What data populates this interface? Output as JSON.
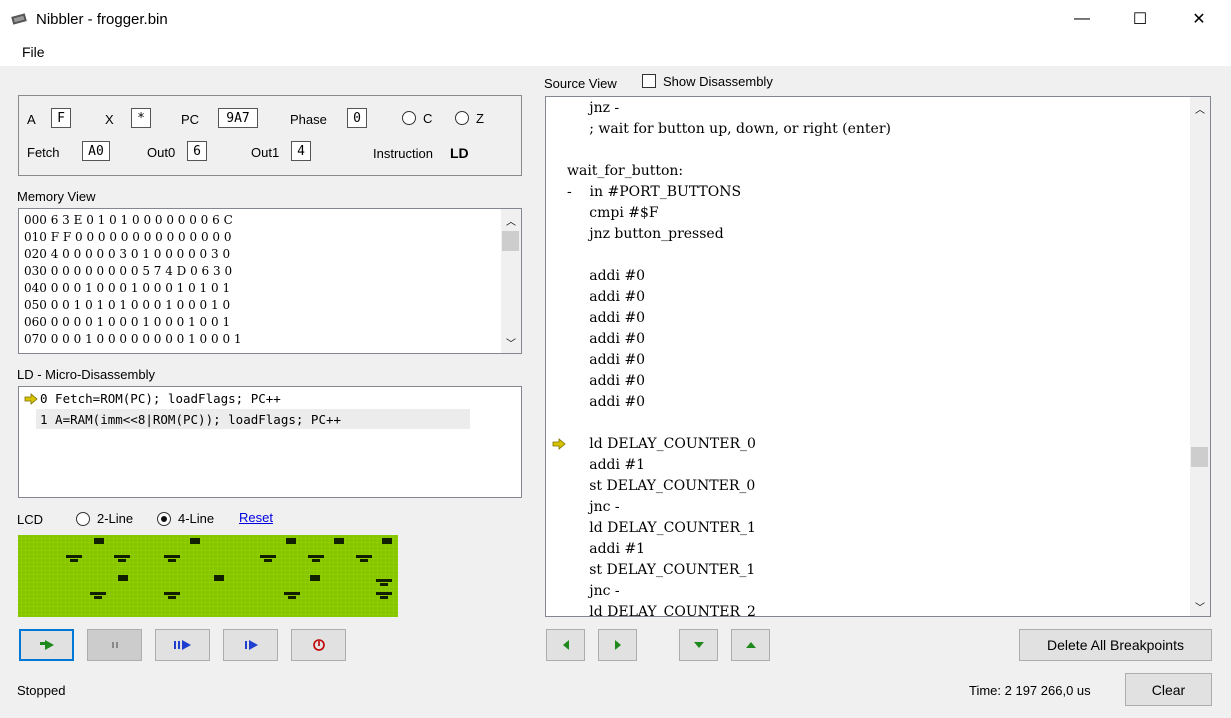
{
  "window": {
    "title": "Nibbler - frogger.bin",
    "minimize_glyph": "—",
    "maximize_glyph": "☐",
    "close_glyph": "✕"
  },
  "menu": {
    "file": "File"
  },
  "registers": {
    "a_label": "A",
    "a_value": "F",
    "x_label": "X",
    "x_value": "*",
    "pc_label": "PC",
    "pc_value": "9A7",
    "phase_label": "Phase",
    "phase_value": "0",
    "c_label": "C",
    "z_label": "Z",
    "fetch_label": "Fetch",
    "fetch_value": "A0",
    "out0_label": "Out0",
    "out0_value": "6",
    "out1_label": "Out1",
    "out1_value": "4",
    "instruction_label": "Instruction",
    "instruction_value": "LD"
  },
  "memory": {
    "label": "Memory View",
    "rows": [
      "000 6 3 E 0 1 0 1 0 0 0 0 0 0 0 6 C",
      "010 F F 0 0 0 0 0 0 0 0 0 0 0 0 0 0",
      "020 4 0 0 0 0 0 3 0 1 0 0 0 0 0 3 0",
      "030 0 0 0 0 0 0 0 0 5 7 4 D 0 6 3 0",
      "040 0 0 0 1 0 0 0 1 0 0 0 1 0 1 0 1",
      "050 0 0 1 0 1 0 1 0 0 0 1 0 0 0 1 0",
      "060 0 0 0 0 1 0 0 0 1 0 0 0 1 0 0 1",
      "070 0 0 0 1 0 0 0 0 0 0 0 0 1 0 0 0 1"
    ]
  },
  "micro": {
    "label": "LD - Micro-Disassembly",
    "rows": [
      "0 Fetch=ROM(PC); loadFlags; PC++",
      "1 A=RAM(imm<<8|ROM(PC)); loadFlags; PC++"
    ]
  },
  "lcd": {
    "label": "LCD",
    "two_line": "2-Line",
    "four_line": "4-Line",
    "reset": "Reset",
    "mode_selected": "4-Line",
    "bg_color": "#8fcf00"
  },
  "source": {
    "label": "Source View",
    "show_disassembly": "Show Disassembly",
    "lines": [
      "     jnz -",
      "     ; wait for button up, down, or right (enter)",
      "",
      "wait_for_button:",
      "-    in #PORT_BUTTONS",
      "     cmpi #$F",
      "     jnz button_pressed",
      "",
      "     addi #0",
      "     addi #0",
      "     addi #0",
      "     addi #0",
      "     addi #0",
      "     addi #0",
      "     addi #0",
      "",
      "     ld DELAY_COUNTER_0",
      "     addi #1",
      "     st DELAY_COUNTER_0",
      "     jnc -",
      "     ld DELAY_COUNTER_1",
      "     addi #1",
      "     st DELAY_COUNTER_1",
      "     jnc -",
      "     ld DELAY_COUNTER_2"
    ]
  },
  "buttons": {
    "delete_breakpoints": "Delete All Breakpoints",
    "clear": "Clear"
  },
  "status": {
    "state": "Stopped",
    "time": "Time: 2 197 266,0 us"
  },
  "colors": {
    "arrow": "#d6c400",
    "run_green": "#1e8a1e",
    "step_blue": "#1f3fd0",
    "stop_red": "#c00000"
  }
}
